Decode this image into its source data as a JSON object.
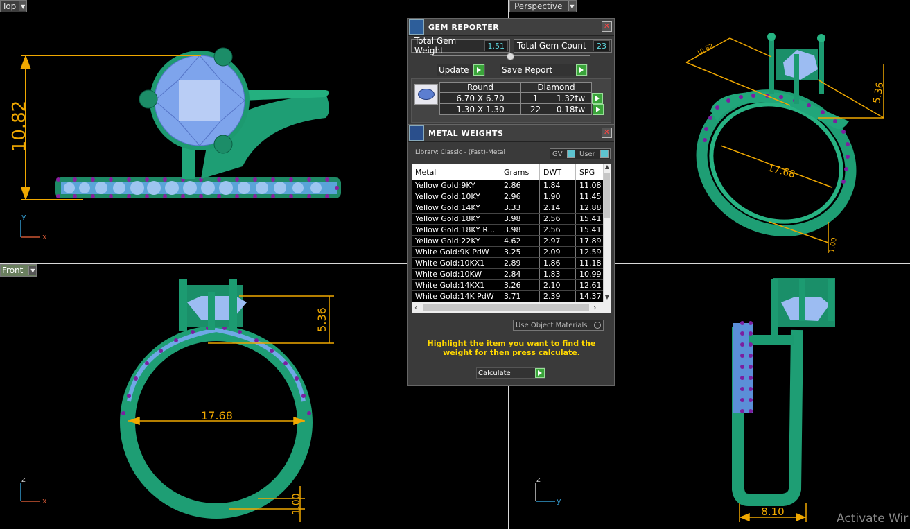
{
  "viewports": {
    "top": {
      "label": "Top",
      "dimension": "10.82",
      "axis_a": "y",
      "axis_b": "x"
    },
    "perspective": {
      "label": "Perspective",
      "dim_width": "17.68",
      "dim_height": "5.36",
      "dim_diag": "10.82",
      "dim_small": "1.00"
    },
    "front": {
      "label": "Front",
      "dim_width": "17.68",
      "dim_height": "5.36",
      "dim_bottom": "1.00",
      "axis_a": "z",
      "axis_b": "x"
    },
    "right": {
      "dim_width": "8.10",
      "axis_a": "z",
      "axis_b": "y"
    }
  },
  "gem_reporter": {
    "title": "GEM REPORTER",
    "total_weight_label": "Total Gem Weight",
    "total_weight_value": "1.51",
    "total_count_label": "Total Gem Count",
    "total_count_value": "23",
    "update_label": "Update",
    "save_report_label": "Save Report",
    "columns": [
      "Round",
      "Diamond"
    ],
    "rows": [
      {
        "size": "6.70 X 6.70",
        "count": "1",
        "weight": "1.32tw"
      },
      {
        "size": "1.30 X 1.30",
        "count": "22",
        "weight": "0.18tw"
      }
    ]
  },
  "metal_weights": {
    "title": "METAL WEIGHTS",
    "library_label": "Library: Classic - (Fast)-Metal",
    "gv_label": "GV",
    "user_label": "User",
    "headers": [
      "Metal",
      "Grams",
      "DWT",
      "SPG"
    ],
    "rows": [
      [
        "Yellow Gold:9KY",
        "2.86",
        "1.84",
        "11.08"
      ],
      [
        "Yellow Gold:10KY",
        "2.96",
        "1.90",
        "11.45"
      ],
      [
        "Yellow Gold:14KY",
        "3.33",
        "2.14",
        "12.88"
      ],
      [
        "Yellow Gold:18KY",
        "3.98",
        "2.56",
        "15.41"
      ],
      [
        "Yellow Gold:18KY R...",
        "3.98",
        "2.56",
        "15.41"
      ],
      [
        "Yellow Gold:22KY",
        "4.62",
        "2.97",
        "17.89"
      ],
      [
        "White Gold:9K PdW",
        "3.25",
        "2.09",
        "12.59"
      ],
      [
        "White Gold:10KX1",
        "2.89",
        "1.86",
        "11.18"
      ],
      [
        "White Gold:10KW",
        "2.84",
        "1.83",
        "10.99"
      ],
      [
        "White Gold:14KX1",
        "3.26",
        "2.10",
        "12.61"
      ],
      [
        "White Gold:14K PdW",
        "3.71",
        "2.39",
        "14.37"
      ]
    ],
    "use_object_materials_label": "Use Object Materials",
    "instruction": "Highlight the item you want to find the weight for then press calculate.",
    "calculate_label": "Calculate"
  },
  "watermark": "Activate Wir"
}
